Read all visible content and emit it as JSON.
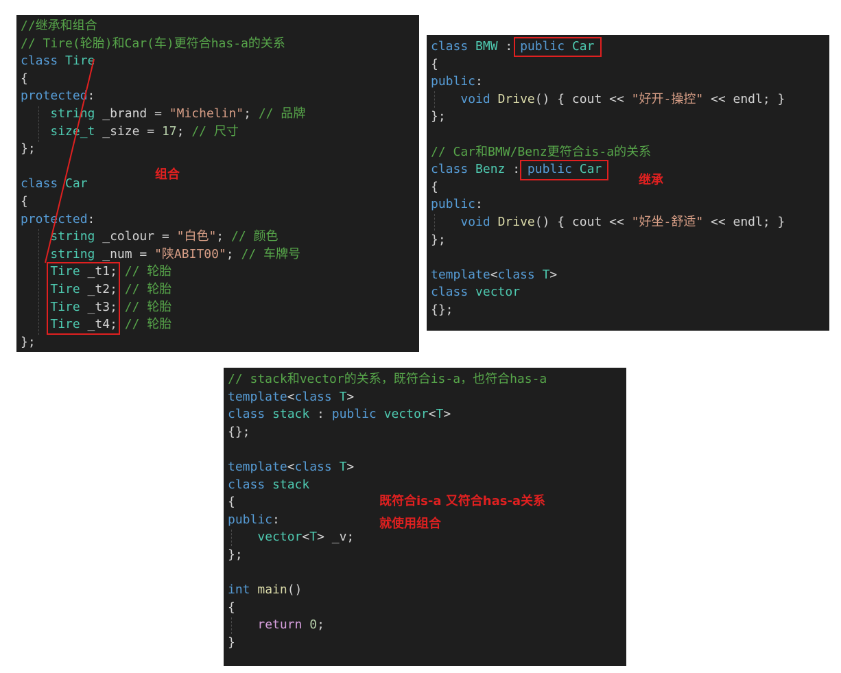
{
  "panels": {
    "left": {
      "lines": [
        [
          [
            "comment",
            "//继承和组合"
          ]
        ],
        [
          [
            "comment",
            "// Tire(轮胎)和Car(车)更符合has-a的关系"
          ]
        ],
        [
          [
            "keyword",
            "class"
          ],
          [
            "ident",
            " "
          ],
          [
            "type",
            "Tire"
          ]
        ],
        [
          [
            "ident",
            "{"
          ]
        ],
        [
          [
            "keyword",
            "protected"
          ],
          [
            "ident",
            ":"
          ]
        ],
        [
          [
            "ident",
            "    "
          ],
          [
            "type",
            "string"
          ],
          [
            "ident",
            " _brand = "
          ],
          [
            "string",
            "\"Michelin\""
          ],
          [
            "ident",
            "; "
          ],
          [
            "comment",
            "// 品牌"
          ]
        ],
        [
          [
            "ident",
            "    "
          ],
          [
            "type",
            "size_t"
          ],
          [
            "ident",
            " _size = "
          ],
          [
            "number",
            "17"
          ],
          [
            "ident",
            "; "
          ],
          [
            "comment",
            "// 尺寸"
          ]
        ],
        [
          [
            "ident",
            "};"
          ]
        ],
        [
          [
            "ident",
            ""
          ]
        ],
        [
          [
            "keyword",
            "class"
          ],
          [
            "ident",
            " "
          ],
          [
            "type",
            "Car"
          ]
        ],
        [
          [
            "ident",
            "{"
          ]
        ],
        [
          [
            "keyword",
            "protected"
          ],
          [
            "ident",
            ":"
          ]
        ],
        [
          [
            "ident",
            "    "
          ],
          [
            "type",
            "string"
          ],
          [
            "ident",
            " _colour = "
          ],
          [
            "string",
            "\"白色\""
          ],
          [
            "ident",
            "; "
          ],
          [
            "comment",
            "// 颜色"
          ]
        ],
        [
          [
            "ident",
            "    "
          ],
          [
            "type",
            "string"
          ],
          [
            "ident",
            " _num = "
          ],
          [
            "string",
            "\"陕ABIT00\""
          ],
          [
            "ident",
            "; "
          ],
          [
            "comment",
            "// 车牌号"
          ]
        ],
        [
          [
            "ident",
            "    "
          ],
          [
            "type",
            "Tire"
          ],
          [
            "ident",
            " _t1; "
          ],
          [
            "comment",
            "// 轮胎"
          ]
        ],
        [
          [
            "ident",
            "    "
          ],
          [
            "type",
            "Tire"
          ],
          [
            "ident",
            " _t2; "
          ],
          [
            "comment",
            "// 轮胎"
          ]
        ],
        [
          [
            "ident",
            "    "
          ],
          [
            "type",
            "Tire"
          ],
          [
            "ident",
            " _t3; "
          ],
          [
            "comment",
            "// 轮胎"
          ]
        ],
        [
          [
            "ident",
            "    "
          ],
          [
            "type",
            "Tire"
          ],
          [
            "ident",
            " _t4; "
          ],
          [
            "comment",
            "// 轮胎"
          ]
        ],
        [
          [
            "ident",
            "};"
          ]
        ]
      ],
      "annotation": "组合"
    },
    "right": {
      "lines": [
        [
          [
            "keyword",
            "class"
          ],
          [
            "ident",
            " "
          ],
          [
            "type",
            "BMW"
          ],
          [
            "ident",
            " : "
          ],
          [
            "keyword",
            "public"
          ],
          [
            "ident",
            " "
          ],
          [
            "type",
            "Car"
          ]
        ],
        [
          [
            "ident",
            "{"
          ]
        ],
        [
          [
            "keyword",
            "public"
          ],
          [
            "ident",
            ":"
          ]
        ],
        [
          [
            "ident",
            "    "
          ],
          [
            "keyword",
            "void"
          ],
          [
            "ident",
            " "
          ],
          [
            "func",
            "Drive"
          ],
          [
            "ident",
            "() { cout << "
          ],
          [
            "string",
            "\"好开-操控\""
          ],
          [
            "ident",
            " << endl; }"
          ]
        ],
        [
          [
            "ident",
            "};"
          ]
        ],
        [
          [
            "ident",
            ""
          ]
        ],
        [
          [
            "comment",
            "// Car和BMW/Benz更符合is-a的关系"
          ]
        ],
        [
          [
            "keyword",
            "class"
          ],
          [
            "ident",
            " "
          ],
          [
            "type",
            "Benz"
          ],
          [
            "ident",
            " : "
          ],
          [
            "keyword",
            "public"
          ],
          [
            "ident",
            " "
          ],
          [
            "type",
            "Car"
          ]
        ],
        [
          [
            "ident",
            "{"
          ]
        ],
        [
          [
            "keyword",
            "public"
          ],
          [
            "ident",
            ":"
          ]
        ],
        [
          [
            "ident",
            "    "
          ],
          [
            "keyword",
            "void"
          ],
          [
            "ident",
            " "
          ],
          [
            "func",
            "Drive"
          ],
          [
            "ident",
            "() { cout << "
          ],
          [
            "string",
            "\"好坐-舒适\""
          ],
          [
            "ident",
            " << endl; }"
          ]
        ],
        [
          [
            "ident",
            "};"
          ]
        ],
        [
          [
            "ident",
            ""
          ]
        ],
        [
          [
            "keyword",
            "template"
          ],
          [
            "ident",
            "<"
          ],
          [
            "keyword",
            "class"
          ],
          [
            "ident",
            " "
          ],
          [
            "type",
            "T"
          ],
          [
            "ident",
            ">"
          ]
        ],
        [
          [
            "keyword",
            "class"
          ],
          [
            "ident",
            " "
          ],
          [
            "type",
            "vector"
          ]
        ],
        [
          [
            "ident",
            "{};"
          ]
        ]
      ],
      "annotation": "继承"
    },
    "bottom": {
      "lines": [
        [
          [
            "comment",
            "// stack和vector的关系，既符合is-a，也符合has-a"
          ]
        ],
        [
          [
            "keyword",
            "template"
          ],
          [
            "ident",
            "<"
          ],
          [
            "keyword",
            "class"
          ],
          [
            "ident",
            " "
          ],
          [
            "type",
            "T"
          ],
          [
            "ident",
            ">"
          ]
        ],
        [
          [
            "keyword",
            "class"
          ],
          [
            "ident",
            " "
          ],
          [
            "type",
            "stack"
          ],
          [
            "ident",
            " : "
          ],
          [
            "keyword",
            "public"
          ],
          [
            "ident",
            " "
          ],
          [
            "type",
            "vector"
          ],
          [
            "ident",
            "<"
          ],
          [
            "type",
            "T"
          ],
          [
            "ident",
            ">"
          ]
        ],
        [
          [
            "ident",
            "{};"
          ]
        ],
        [
          [
            "ident",
            ""
          ]
        ],
        [
          [
            "keyword",
            "template"
          ],
          [
            "ident",
            "<"
          ],
          [
            "keyword",
            "class"
          ],
          [
            "ident",
            " "
          ],
          [
            "type",
            "T"
          ],
          [
            "ident",
            ">"
          ]
        ],
        [
          [
            "keyword",
            "class"
          ],
          [
            "ident",
            " "
          ],
          [
            "type",
            "stack"
          ]
        ],
        [
          [
            "ident",
            "{"
          ]
        ],
        [
          [
            "keyword",
            "public"
          ],
          [
            "ident",
            ":"
          ]
        ],
        [
          [
            "ident",
            "    "
          ],
          [
            "type",
            "vector"
          ],
          [
            "ident",
            "<"
          ],
          [
            "type",
            "T"
          ],
          [
            "ident",
            "> _v;"
          ]
        ],
        [
          [
            "ident",
            "};"
          ]
        ],
        [
          [
            "ident",
            ""
          ]
        ],
        [
          [
            "keyword",
            "int"
          ],
          [
            "ident",
            " "
          ],
          [
            "func",
            "main"
          ],
          [
            "ident",
            "()"
          ]
        ],
        [
          [
            "ident",
            "{"
          ]
        ],
        [
          [
            "ident",
            "    "
          ],
          [
            "control",
            "return"
          ],
          [
            "ident",
            " "
          ],
          [
            "number",
            "0"
          ],
          [
            "ident",
            ";"
          ]
        ],
        [
          [
            "ident",
            "}"
          ]
        ]
      ],
      "annotation_line1": "既符合is-a 又符合has-a关系",
      "annotation_line2": "就使用组合"
    }
  },
  "colors": {
    "background": "#1e1e1e",
    "comment": "#57a64a",
    "keyword": "#569cd6",
    "type": "#4ec9b0",
    "string": "#d69d85",
    "number": "#b5cea8",
    "function": "#dcdcaa",
    "text": "#d4d4d4",
    "annotation": "#e02020"
  }
}
